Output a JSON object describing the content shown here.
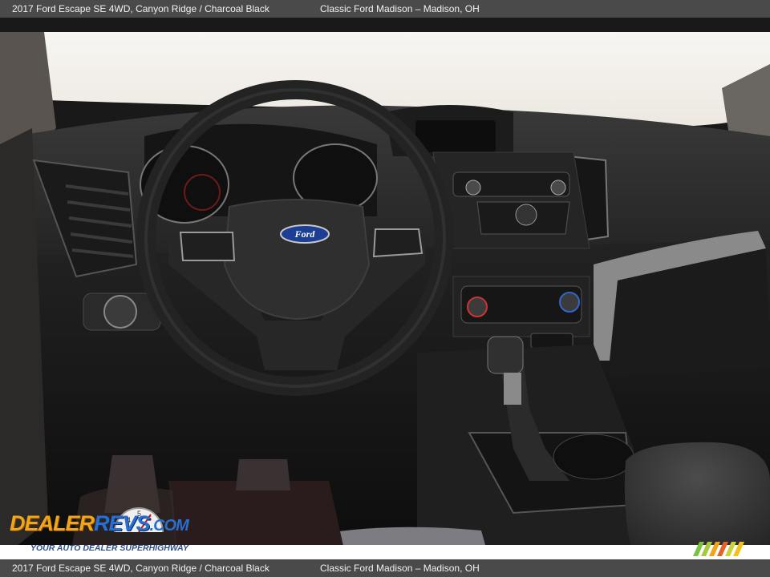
{
  "header": {
    "vehicle": "2017 Ford Escape SE 4WD,  Canyon Ridge / Charcoal Black",
    "dealer": "Classic Ford Madison – Madison, OH"
  },
  "footer": {
    "vehicle": "2017 Ford Escape SE 4WD,  Canyon Ridge / Charcoal Black",
    "dealer": "Classic Ford Madison – Madison, OH"
  },
  "photo": {
    "subject": "dashboard interior",
    "steering_logo": "Ford",
    "colors": {
      "dash": "#2b2a2a",
      "trim": "#8f8f8f",
      "windshield": "#f7f4ef",
      "ford_blue": "#1c3f94"
    }
  },
  "watermark": {
    "brand_first": "DEALER",
    "brand_second": "REVS",
    "brand_suffix": ".COM",
    "tagline": "YOUR AUTO DEALER SUPERHIGHWAY"
  },
  "corner_icon": "color-stripes-icon"
}
